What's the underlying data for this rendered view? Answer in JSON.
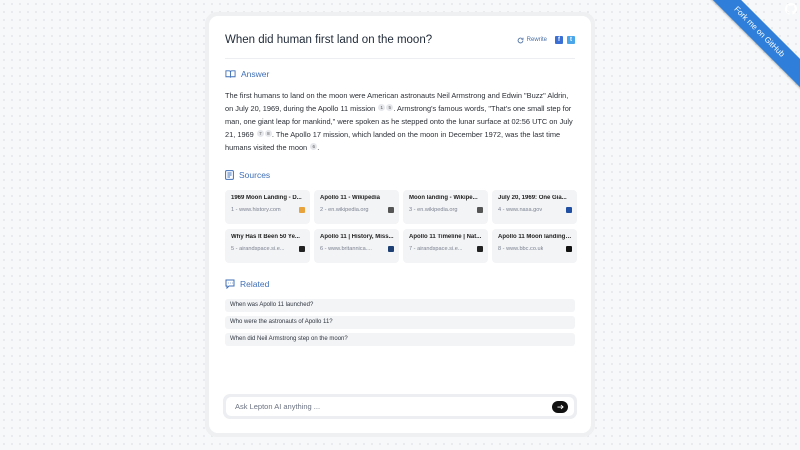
{
  "ribbon": {
    "label": "Fork me on GitHub"
  },
  "header": {
    "query": "When did human first land on the moon?",
    "rewrite_label": "Rewrite",
    "share_facebook": "f",
    "share_twitter": "t"
  },
  "answer": {
    "heading": "Answer",
    "icon": "book-open-icon",
    "seg1": "The first humans to land on the moon were American astronauts Neil Armstrong and Edwin \"Buzz\" Aldrin, on July 20, 1969, during the Apollo 11 mission",
    "cite1a": "1",
    "cite1b": "5",
    "seg2": ". Armstrong's famous words, \"That's one small step for man, one giant leap for mankind,\" were spoken as he stepped onto the lunar surface at 02:56 UTC on July 21, 1969",
    "cite2a": "7",
    "cite2b": "8",
    "seg3": ". The Apollo 17 mission, which landed on the moon in December 1972, was the last time humans visited the moon",
    "cite3": "6",
    "seg4": "."
  },
  "sources": {
    "heading": "Sources",
    "icon": "document-icon",
    "items": [
      {
        "title": "1969 Moon Landing - D...",
        "meta": "1 - www.history.com",
        "favicon_color": "#e8a33d"
      },
      {
        "title": "Apollo 11 - Wikipedia",
        "meta": "2 - en.wikipedia.org",
        "favicon_color": "#555555"
      },
      {
        "title": "Moon landing - Wikipe...",
        "meta": "3 - en.wikipedia.org",
        "favicon_color": "#555555"
      },
      {
        "title": "July 20, 1969: One Gia...",
        "meta": "4 - www.nasa.gov",
        "favicon_color": "#1f4fa3"
      },
      {
        "title": "Why Has It Been 50 Ye...",
        "meta": "5 - airandspace.si.e...",
        "favicon_color": "#222222"
      },
      {
        "title": "Apollo 11 | History, Miss...",
        "meta": "6 - www.britannica....",
        "favicon_color": "#1d3f73"
      },
      {
        "title": "Apollo 11 Timeline | Nat...",
        "meta": "7 - airandspace.si.e...",
        "favicon_color": "#222222"
      },
      {
        "title": "Apollo 11 Moon landing:...",
        "meta": "8 - www.bbc.co.uk",
        "favicon_color": "#111111"
      }
    ]
  },
  "related": {
    "heading": "Related",
    "icon": "chat-icon",
    "items": [
      "When was Apollo 11 launched?",
      "Who were the astronauts of Apollo 11?",
      "When did Neil Armstrong step on the moon?"
    ]
  },
  "search": {
    "placeholder": "Ask Lepton AI anything ..."
  },
  "colors": {
    "accent": "#3f6fb6",
    "ribbon": "#2f7fda"
  }
}
